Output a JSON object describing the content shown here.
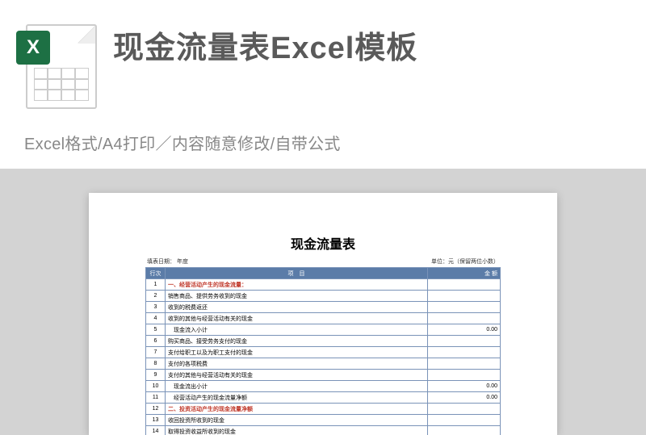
{
  "header": {
    "icon_letter": "X",
    "title": "现金流量表Excel模板",
    "subtitle": "Excel格式/A4打印／内容随意修改/自带公式"
  },
  "doc": {
    "title": "现金流量表",
    "meta_left": "填表日期：  年度",
    "meta_right": "单位：元（保留两位小数）",
    "columns": {
      "c1": "行次",
      "c2": "项　目",
      "c3": "金 额"
    },
    "rows": [
      {
        "n": "1",
        "label": "一、经营活动产生的现金流量：",
        "cls": "section-red",
        "amt": ""
      },
      {
        "n": "2",
        "label": "销售商品、提供劳务收到的现金",
        "amt": ""
      },
      {
        "n": "3",
        "label": "收到的税费返还",
        "amt": ""
      },
      {
        "n": "4",
        "label": "收到的其他与经营活动有关的现金",
        "amt": ""
      },
      {
        "n": "5",
        "label": "　现金流入小计",
        "amt": "0.00"
      },
      {
        "n": "6",
        "label": "购买商品、接受劳务支付的现金",
        "amt": ""
      },
      {
        "n": "7",
        "label": "支付给职工以及为职工支付的现金",
        "amt": ""
      },
      {
        "n": "8",
        "label": "支付的各项税费",
        "amt": ""
      },
      {
        "n": "9",
        "label": "支付的其他与经营活动有关的现金",
        "amt": ""
      },
      {
        "n": "10",
        "label": "　现金流出小计",
        "amt": "0.00"
      },
      {
        "n": "11",
        "label": "　经营活动产生的现金流量净额",
        "amt": "0.00"
      },
      {
        "n": "12",
        "label": "二、投资活动产生的现金流量净额",
        "cls": "section-red",
        "amt": ""
      },
      {
        "n": "13",
        "label": "收回投资所收到的现金",
        "amt": ""
      },
      {
        "n": "14",
        "label": "取得投资收益所收到的现金",
        "amt": ""
      }
    ]
  }
}
